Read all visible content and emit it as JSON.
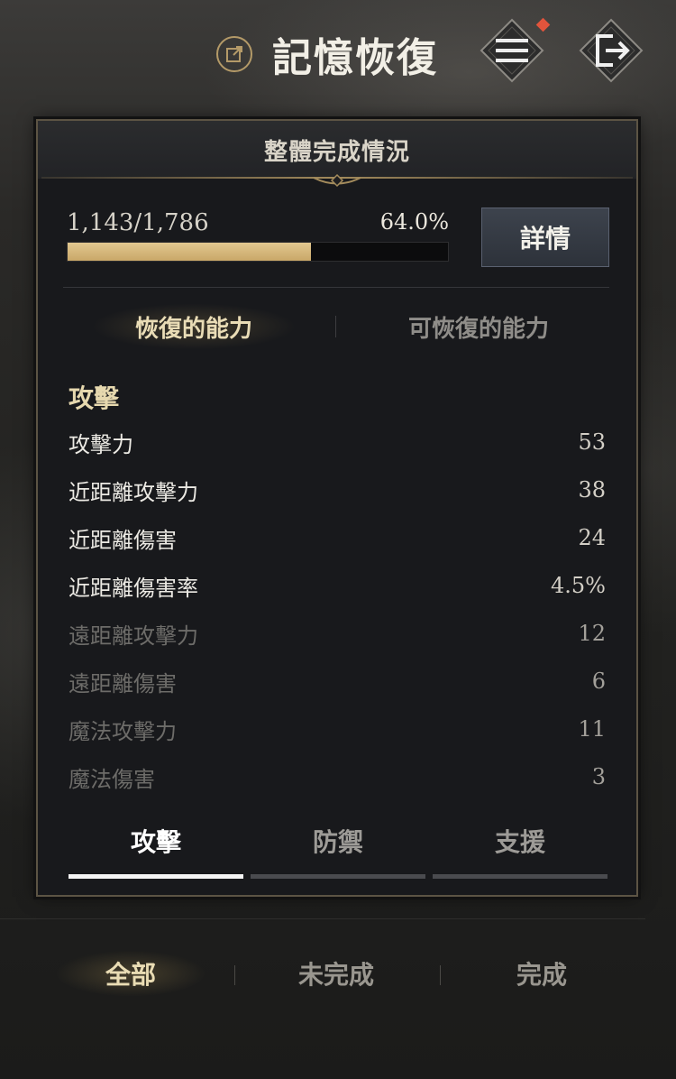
{
  "header": {
    "title": "記憶恢復",
    "icons": {
      "title": "external-link-icon",
      "menu": "menu-icon",
      "exit": "exit-icon"
    },
    "notification_color": "#e2543c"
  },
  "panel": {
    "title": "整體完成情況",
    "progress": {
      "text": "1,143/1,786",
      "percent_text": "64.0%",
      "fraction": 0.64
    },
    "detail_button": "詳情",
    "subtabs": {
      "active": "恢復的能力",
      "inactive": "可恢復的能力"
    },
    "section_title": "攻擊",
    "stats": [
      {
        "name": "攻擊力",
        "value": "53"
      },
      {
        "name": "近距離攻擊力",
        "value": "38"
      },
      {
        "name": "近距離傷害",
        "value": "24"
      },
      {
        "name": "近距離傷害率",
        "value": "4.5%"
      },
      {
        "name": "遠距離攻擊力",
        "value": "12"
      },
      {
        "name": "遠距離傷害",
        "value": "6"
      },
      {
        "name": "魔法攻擊力",
        "value": "11"
      },
      {
        "name": "魔法傷害",
        "value": "3"
      }
    ],
    "category_tabs": [
      "攻擊",
      "防禦",
      "支援"
    ]
  },
  "filters": [
    "全部",
    "未完成",
    "完成"
  ],
  "colors": {
    "accent_gold": "#e6d8ae",
    "progress_fill": "#d9bb7c",
    "panel_bg": "#18191c"
  }
}
